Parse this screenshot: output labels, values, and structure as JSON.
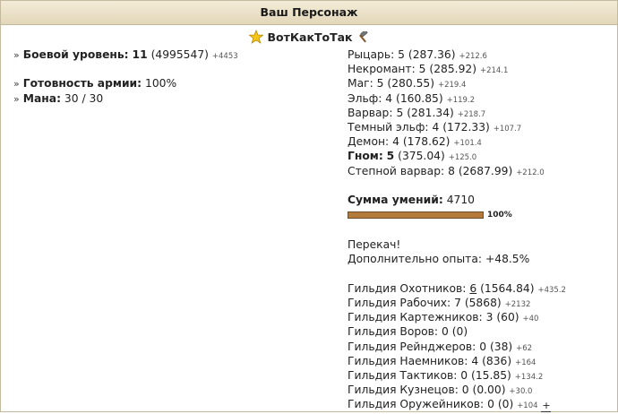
{
  "header": {
    "title": "Ваш Персонаж"
  },
  "character": {
    "name": "ВотКакТоТак"
  },
  "stats": {
    "combat_level_label": "Боевой уровень:",
    "combat_level": "11",
    "combat_exp": "(4995547)",
    "combat_exp_delta": "+4453",
    "army_ready_label": "Готовность армии:",
    "army_ready_value": "100%",
    "mana_label": "Мана:",
    "mana_value": "30 / 30"
  },
  "factions": [
    {
      "name": "Рыцарь:",
      "level": "5",
      "points": "(287.36)",
      "delta": "+212.6",
      "bold": false
    },
    {
      "name": "Некромант:",
      "level": "5",
      "points": "(285.92)",
      "delta": "+214.1",
      "bold": false
    },
    {
      "name": "Маг:",
      "level": "5",
      "points": "(280.55)",
      "delta": "+219.4",
      "bold": false
    },
    {
      "name": "Эльф:",
      "level": "4",
      "points": "(160.85)",
      "delta": "+119.2",
      "bold": false
    },
    {
      "name": "Варвар:",
      "level": "5",
      "points": "(281.34)",
      "delta": "+218.7",
      "bold": false
    },
    {
      "name": "Темный эльф:",
      "level": "4",
      "points": "(172.33)",
      "delta": "+107.7",
      "bold": false
    },
    {
      "name": "Демон:",
      "level": "4",
      "points": "(178.62)",
      "delta": "+101.4",
      "bold": false
    },
    {
      "name": "Гном:",
      "level": "5",
      "points": "(375.04)",
      "delta": "+125.0",
      "bold": true
    },
    {
      "name": "Степной варвар:",
      "level": "8",
      "points": "(2687.99)",
      "delta": "+212.0",
      "bold": false
    }
  ],
  "skills": {
    "label": "Сумма умений:",
    "value": "4710",
    "progress_pct": 100,
    "progress_label": "100%"
  },
  "exp": {
    "overleveled": "Перекач!",
    "extra_label": "Дополнительно опыта:",
    "extra_value": "+48.5%"
  },
  "guilds": [
    {
      "name": "Гильдия Охотников:",
      "level": "6",
      "points": "(1564.84)",
      "delta": "+435.2",
      "link": true
    },
    {
      "name": "Гильдия Рабочих:",
      "level": "7",
      "points": "(5868)",
      "delta": "+2132",
      "link": false
    },
    {
      "name": "Гильдия Картежников:",
      "level": "3",
      "points": "(60)",
      "delta": "+40",
      "link": false
    },
    {
      "name": "Гильдия Воров:",
      "level": "0",
      "points": "(0)",
      "delta": "",
      "link": false
    },
    {
      "name": "Гильдия Рейнджеров:",
      "level": "0",
      "points": "(38)",
      "delta": "+62",
      "link": false
    },
    {
      "name": "Гильдия Наемников:",
      "level": "4",
      "points": "(836)",
      "delta": "+164",
      "link": false
    },
    {
      "name": "Гильдия Тактиков:",
      "level": "0",
      "points": "(15.85)",
      "delta": "+134.2",
      "link": false
    },
    {
      "name": "Гильдия Кузнецов:",
      "level": "0",
      "points": "(0.00)",
      "delta": "+30.0",
      "link": false
    },
    {
      "name": "Гильдия Оружейников:",
      "level": "0",
      "points": "(0)",
      "delta": "+104",
      "link": false
    }
  ],
  "plus_button": {
    "label": "+"
  },
  "icons": {
    "star": "star-icon",
    "hammer": "hammer-icon"
  }
}
